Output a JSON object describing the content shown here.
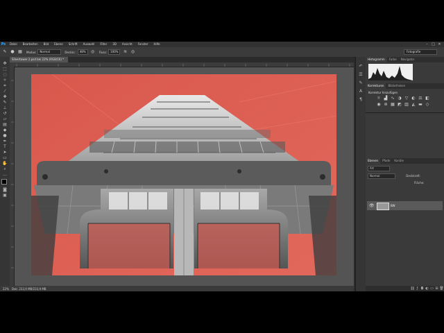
{
  "app": {
    "logo": "Ps"
  },
  "menu": [
    "Datei",
    "Bearbeiten",
    "Bild",
    "Ebene",
    "Schrift",
    "Auswahl",
    "Filter",
    "3D",
    "Ansicht",
    "Fenster",
    "Hilfe"
  ],
  "window_controls": [
    "–",
    "□",
    "✕"
  ],
  "options": {
    "mode_label": "Modus:",
    "mode_value": "Normal",
    "opacity_label": "Deckkr.:",
    "opacity_value": "48%",
    "flow_label": "Fluss:",
    "flow_value": "100%",
    "workspace": "Fotografie"
  },
  "document": {
    "tab_title": "Silvertower 2.psd bei 22% (RGB/16) *",
    "zoom": "22%",
    "doc_info": "Dok: 233,9 MB/233,9 MB"
  },
  "panels": {
    "histogram_tabs": [
      "Histogramm",
      "Farbe",
      "Navigator"
    ],
    "adjust_tabs": [
      "Korrekturen",
      "Bibliotheken"
    ],
    "adjust_title": "Korrektur hinzufügen",
    "layers_tabs": [
      "Ebenen",
      "Pfade",
      "Kanäle"
    ],
    "kind_filter": "Art",
    "blend_mode": "Normal",
    "opacity_label": "Deckkraft:",
    "fill_label": "Fläche:",
    "layer_name": "BW"
  },
  "colors": {
    "photo_background": "#dc5e52",
    "app_bg": "#2b2b2b",
    "canvas_bg": "#545454"
  }
}
